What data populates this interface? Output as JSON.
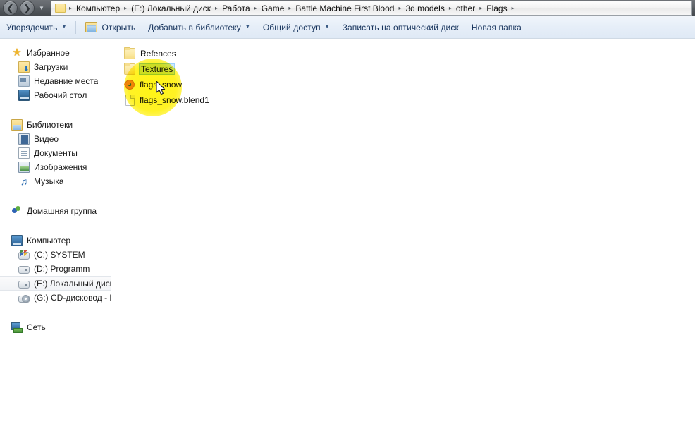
{
  "addressbar": {
    "back_icon": "back-arrow-icon",
    "forward_icon": "forward-arrow-icon",
    "dropdown_icon": "chevron-down-icon",
    "separator": "▸",
    "crumbs": [
      "Компьютер",
      "(E:) Локальный диск",
      "Работа",
      "Game",
      "Battle Machine First Blood",
      "3d models",
      "other",
      "Flags"
    ]
  },
  "toolbar": {
    "organize_label": "Упорядочить",
    "open_label": "Открыть",
    "add_to_library_label": "Добавить в библиотеку",
    "share_label": "Общий доступ",
    "burn_label": "Записать на оптический диск",
    "new_folder_label": "Новая папка",
    "caret": "▼"
  },
  "navpane": {
    "groups": [
      {
        "header": {
          "label": "Избранное",
          "icon": "star-icon"
        },
        "items": [
          {
            "label": "Загрузки",
            "icon": "downloads-icon"
          },
          {
            "label": "Недавние места",
            "icon": "recent-places-icon"
          },
          {
            "label": "Рабочий стол",
            "icon": "desktop-icon"
          }
        ]
      },
      {
        "header": {
          "label": "Библиотеки",
          "icon": "libraries-icon"
        },
        "items": [
          {
            "label": "Видео",
            "icon": "video-icon"
          },
          {
            "label": "Документы",
            "icon": "documents-icon"
          },
          {
            "label": "Изображения",
            "icon": "pictures-icon"
          },
          {
            "label": "Музыка",
            "icon": "music-icon"
          }
        ]
      },
      {
        "header": {
          "label": "Домашняя группа",
          "icon": "homegroup-icon"
        },
        "items": []
      },
      {
        "header": {
          "label": "Компьютер",
          "icon": "computer-icon"
        },
        "items": [
          {
            "label": "(C:) SYSTEM",
            "icon": "system-drive-icon",
            "selected": false
          },
          {
            "label": "(D:) Programm",
            "icon": "drive-icon",
            "selected": false
          },
          {
            "label": "(E:) Локальный диск",
            "icon": "drive-icon",
            "selected": true
          },
          {
            "label": "(G:) CD-дисковод - D",
            "icon": "cd-drive-icon",
            "selected": false
          }
        ]
      },
      {
        "header": {
          "label": "Сеть",
          "icon": "network-icon"
        },
        "items": []
      }
    ]
  },
  "filelist": {
    "items": [
      {
        "name": "Refences",
        "icon": "folder-icon",
        "selected": false
      },
      {
        "name": "Textures",
        "icon": "folder-icon",
        "selected": true
      },
      {
        "name": "flags_snow",
        "icon": "blender-file-icon",
        "selected": false
      },
      {
        "name": "flags_snow.blend1",
        "icon": "generic-file-icon",
        "selected": false
      }
    ]
  },
  "overlay": {
    "click_highlight_color": "#fff300",
    "cursor_icon": "mouse-pointer-icon",
    "selection_color": "#cce8ff"
  }
}
